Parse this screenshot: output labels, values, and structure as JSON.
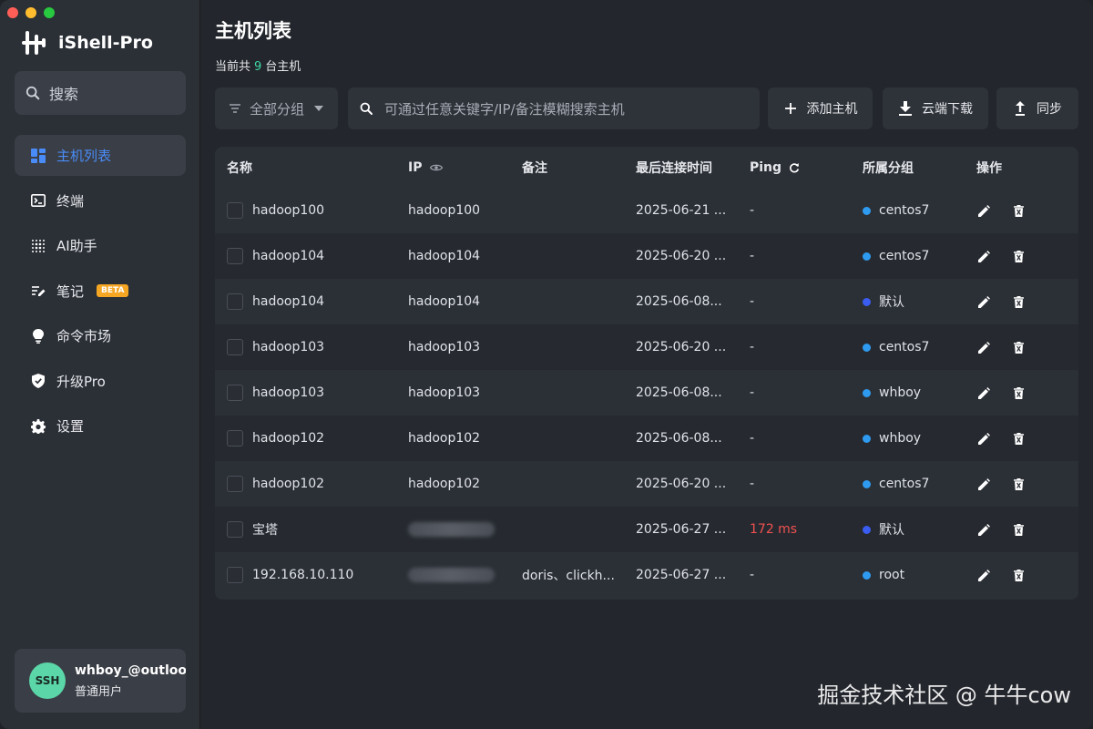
{
  "app": {
    "name": "iShell-Pro"
  },
  "sidebar": {
    "search_label": "搜索",
    "items": [
      {
        "label": "主机列表",
        "icon": "grid-icon",
        "active": true
      },
      {
        "label": "终端",
        "icon": "terminal-icon"
      },
      {
        "label": "AI助手",
        "icon": "ai-dots-icon"
      },
      {
        "label": "笔记",
        "icon": "note-edit-icon",
        "badge": "BETA"
      },
      {
        "label": "命令市场",
        "icon": "lightbulb-icon"
      },
      {
        "label": "升级Pro",
        "icon": "shield-icon"
      },
      {
        "label": "设置",
        "icon": "gear-icon"
      }
    ],
    "user": {
      "avatar_text": "SSH",
      "email": "whboy_@outlook.com",
      "role": "普通用户"
    }
  },
  "main": {
    "title": "主机列表",
    "subtitle_prefix": "当前共",
    "host_count": "9",
    "subtitle_suffix": "台主机",
    "toolbar": {
      "group_filter": "全部分组",
      "search_placeholder": "可通过任意关键字/IP/备注模糊搜索主机",
      "add_label": "添加主机",
      "cloud_label": "云端下载",
      "sync_label": "同步"
    },
    "table": {
      "headers": [
        "名称",
        "IP",
        "备注",
        "最后连接时间",
        "Ping",
        "所属分组",
        "操作"
      ],
      "rows": [
        {
          "name": "hadoop100",
          "ip": "hadoop100",
          "note": "",
          "last": "2025-06-21 ...",
          "ping": "-",
          "group": "centos7",
          "group_color": "#2f9bf0"
        },
        {
          "name": "hadoop104",
          "ip": "hadoop104",
          "note": "",
          "last": "2025-06-20 ...",
          "ping": "-",
          "group": "centos7",
          "group_color": "#2f9bf0"
        },
        {
          "name": "hadoop104",
          "ip": "hadoop104",
          "note": "",
          "last": "2025-06-08...",
          "ping": "-",
          "group": "默认",
          "group_color": "#3a5cf0"
        },
        {
          "name": "hadoop103",
          "ip": "hadoop103",
          "note": "",
          "last": "2025-06-20 ...",
          "ping": "-",
          "group": "centos7",
          "group_color": "#2f9bf0"
        },
        {
          "name": "hadoop103",
          "ip": "hadoop103",
          "note": "",
          "last": "2025-06-08...",
          "ping": "-",
          "group": "whboy",
          "group_color": "#2f9bf0"
        },
        {
          "name": "hadoop102",
          "ip": "hadoop102",
          "note": "",
          "last": "2025-06-08...",
          "ping": "-",
          "group": "whboy",
          "group_color": "#2f9bf0"
        },
        {
          "name": "hadoop102",
          "ip": "hadoop102",
          "note": "",
          "last": "2025-06-20 ...",
          "ping": "-",
          "group": "centos7",
          "group_color": "#2f9bf0"
        },
        {
          "name": "宝塔",
          "ip": "",
          "ip_blurred": true,
          "note": "",
          "last": "2025-06-27 ...",
          "ping": "172 ms",
          "ping_alert": true,
          "group": "默认",
          "group_color": "#3a5cf0"
        },
        {
          "name": "192.168.10.110",
          "ip": "",
          "ip_blurred": true,
          "note": "doris、clickh...",
          "last": "2025-06-27 ...",
          "ping": "-",
          "group": "root",
          "group_color": "#2f9bf0"
        }
      ]
    }
  },
  "watermark": "掘金技术社区 @ 牛牛cow"
}
